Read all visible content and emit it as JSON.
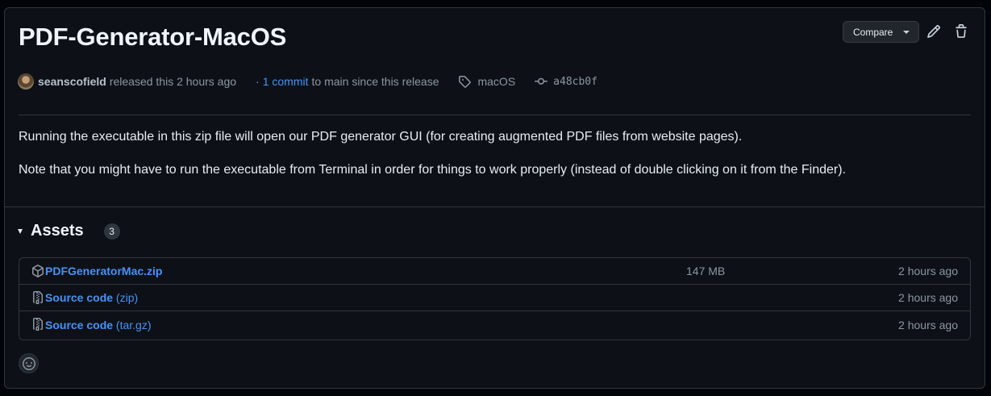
{
  "release": {
    "title": "PDF-Generator-MacOS",
    "compare_label": "Compare",
    "author": "seanscofield",
    "released_text": "released this 2 hours ago",
    "commit_prefix": "·",
    "commit_link": "1 commit",
    "commit_suffix": "to main since this release",
    "tag": "macOS",
    "commit_sha": "a48cb0f",
    "body": [
      "Running the executable in this zip file will open our PDF generator GUI (for creating augmented PDF files from website pages).",
      "Note that you might have to run the executable from Terminal in order for things to work properly (instead of double clicking on it from the Finder)."
    ]
  },
  "assets": {
    "heading": "Assets",
    "count": "3",
    "rows": [
      {
        "name": "PDFGeneratorMac.zip",
        "ext": "",
        "size": "147 MB",
        "time": "2 hours ago",
        "icon": "package-icon"
      },
      {
        "name": "Source code",
        "ext": "(zip)",
        "size": "",
        "time": "2 hours ago",
        "icon": "file-zip-icon"
      },
      {
        "name": "Source code",
        "ext": "(tar.gz)",
        "size": "",
        "time": "2 hours ago",
        "icon": "file-zip-icon"
      }
    ]
  },
  "colors": {
    "link": "#4493f8",
    "background": "#0d1117",
    "border": "#30363d"
  }
}
